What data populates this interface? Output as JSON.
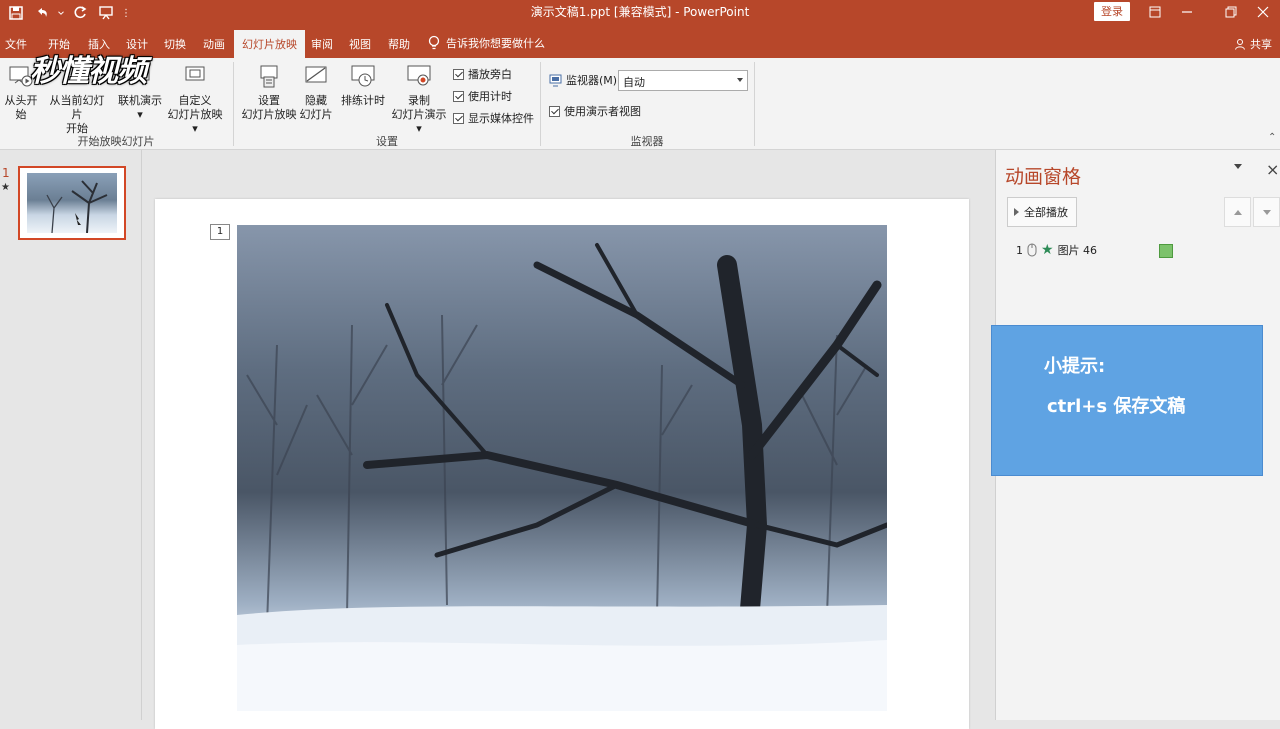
{
  "window": {
    "title": "演示文稿1.ppt [兼容模式] - PowerPoint",
    "login": "登录"
  },
  "tabs": [
    "文件",
    "开始",
    "插入",
    "设计",
    "切换",
    "动画",
    "幻灯片放映",
    "审阅",
    "视图",
    "帮助"
  ],
  "active_tab": "幻灯片放映",
  "tellme": "告诉我你想要做什么",
  "share": "共享",
  "watermark": "秒懂视频",
  "ribbon": {
    "start_group": {
      "from_beginning": "从头开始",
      "from_current_line1": "从当前幻灯片",
      "from_current_line2": "开始",
      "online_present": "联机演示",
      "custom_line1": "自定义",
      "custom_line2": "幻灯片放映",
      "label": "开始放映幻灯片"
    },
    "setup_group": {
      "setup_line1": "设置",
      "setup_line2": "幻灯片放映",
      "hide_line1": "隐藏",
      "hide_line2": "幻灯片",
      "rehearse": "排练计时",
      "record_line1": "录制",
      "record_line2": "幻灯片演示",
      "play_narration": "播放旁白",
      "use_timings": "使用计时",
      "show_media": "显示媒体控件",
      "label": "设置"
    },
    "monitor_group": {
      "monitor_label": "监视器(M):",
      "monitor_value": "自动",
      "presenter_view": "使用演示者视图",
      "label": "监视器"
    }
  },
  "slides_pane": {
    "slide_number": "1",
    "star": "★"
  },
  "slide": {
    "anim_tag": "1"
  },
  "animation_pane": {
    "title": "动画窗格",
    "close": "×",
    "play_all": "全部播放",
    "item_number": "1",
    "item_name": "图片 46"
  },
  "tip": {
    "title": "小提示:",
    "body": "ctrl+s 保存文稿"
  },
  "colors": {
    "accent": "#b7472a",
    "tip_bg": "#5fa3e3",
    "timing_bar": "#7cc26b"
  }
}
